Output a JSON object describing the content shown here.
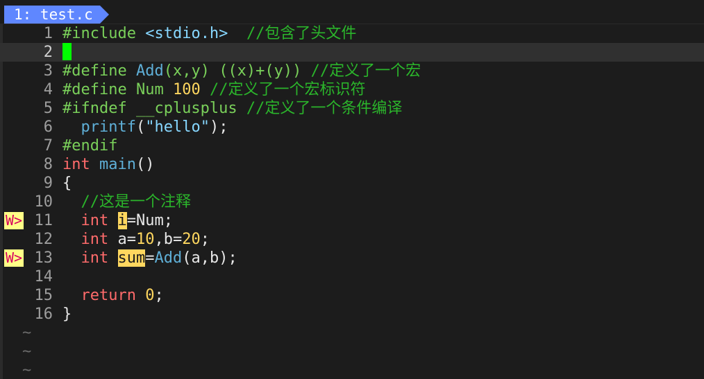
{
  "tabline": {
    "active_tab": "1: test.c"
  },
  "colors": {
    "tab_bg": "#5f87ff",
    "cursor": "#00ff00",
    "warning_sign_bg": "#ffff87",
    "warning_sign_fg": "#d7005f",
    "preprocessor": "#7ad05a",
    "comment": "#2bb52b",
    "function": "#5fafd7",
    "keyword": "#ff6b6b",
    "number": "#ffd75f"
  },
  "editor": {
    "current_line": 2,
    "lines": [
      {
        "num": "1",
        "sign": "",
        "tokens": [
          {
            "t": "#include",
            "c": "pp"
          },
          {
            "t": " ",
            "c": "op"
          },
          {
            "t": "<stdio.h>",
            "c": "str"
          },
          {
            "t": "  ",
            "c": "op"
          },
          {
            "t": "//包含了头文件",
            "c": "cm"
          }
        ]
      },
      {
        "num": "2",
        "sign": "",
        "tokens": [],
        "cursor": true
      },
      {
        "num": "3",
        "sign": "",
        "tokens": [
          {
            "t": "#define",
            "c": "pp"
          },
          {
            "t": " ",
            "c": "op"
          },
          {
            "t": "Add",
            "c": "fn"
          },
          {
            "t": "(x,y) ((x)+(y)) ",
            "c": "pp"
          },
          {
            "t": "//定义了一个宏",
            "c": "cm"
          }
        ]
      },
      {
        "num": "4",
        "sign": "",
        "tokens": [
          {
            "t": "#define Num ",
            "c": "pp"
          },
          {
            "t": "100",
            "c": "nm"
          },
          {
            "t": " ",
            "c": "op"
          },
          {
            "t": "//定义了一个宏标识符",
            "c": "cm"
          }
        ]
      },
      {
        "num": "5",
        "sign": "",
        "tokens": [
          {
            "t": "#ifndef __cplusplus ",
            "c": "pp"
          },
          {
            "t": "//定义了一个条件编译",
            "c": "cm"
          }
        ]
      },
      {
        "num": "6",
        "sign": "",
        "tokens": [
          {
            "t": "  ",
            "c": "op"
          },
          {
            "t": "printf",
            "c": "fn"
          },
          {
            "t": "(",
            "c": "op"
          },
          {
            "t": "\"hello\"",
            "c": "str"
          },
          {
            "t": ");",
            "c": "op"
          }
        ]
      },
      {
        "num": "7",
        "sign": "",
        "tokens": [
          {
            "t": "#endif",
            "c": "pp"
          }
        ]
      },
      {
        "num": "8",
        "sign": "",
        "tokens": [
          {
            "t": "int",
            "c": "kw"
          },
          {
            "t": " ",
            "c": "op"
          },
          {
            "t": "main",
            "c": "fn"
          },
          {
            "t": "()",
            "c": "op"
          }
        ]
      },
      {
        "num": "9",
        "sign": "",
        "tokens": [
          {
            "t": "{",
            "c": "op"
          }
        ]
      },
      {
        "num": "10",
        "sign": "",
        "tokens": [
          {
            "t": "  ",
            "c": "op"
          },
          {
            "t": "//这是一个注释",
            "c": "cm"
          }
        ]
      },
      {
        "num": "11",
        "sign": "W>",
        "tokens": [
          {
            "t": "  ",
            "c": "op"
          },
          {
            "t": "int",
            "c": "kw"
          },
          {
            "t": " ",
            "c": "op"
          },
          {
            "t": "i",
            "c": "hl"
          },
          {
            "t": "=Num;",
            "c": "op"
          }
        ]
      },
      {
        "num": "12",
        "sign": "",
        "tokens": [
          {
            "t": "  ",
            "c": "op"
          },
          {
            "t": "int",
            "c": "kw"
          },
          {
            "t": " a=",
            "c": "op"
          },
          {
            "t": "10",
            "c": "nm"
          },
          {
            "t": ",b=",
            "c": "op"
          },
          {
            "t": "20",
            "c": "nm"
          },
          {
            "t": ";",
            "c": "op"
          }
        ]
      },
      {
        "num": "13",
        "sign": "W>",
        "tokens": [
          {
            "t": "  ",
            "c": "op"
          },
          {
            "t": "int",
            "c": "kw"
          },
          {
            "t": " ",
            "c": "op"
          },
          {
            "t": "sum",
            "c": "hl"
          },
          {
            "t": "=",
            "c": "op"
          },
          {
            "t": "Add",
            "c": "fn"
          },
          {
            "t": "(a,b);",
            "c": "op"
          }
        ]
      },
      {
        "num": "14",
        "sign": "",
        "tokens": []
      },
      {
        "num": "15",
        "sign": "",
        "tokens": [
          {
            "t": "  ",
            "c": "op"
          },
          {
            "t": "return",
            "c": "kw"
          },
          {
            "t": " ",
            "c": "op"
          },
          {
            "t": "0",
            "c": "nm"
          },
          {
            "t": ";",
            "c": "op"
          }
        ]
      },
      {
        "num": "16",
        "sign": "",
        "tokens": [
          {
            "t": "}",
            "c": "op"
          }
        ]
      }
    ],
    "filler_lines": [
      "~",
      "~",
      "~"
    ]
  }
}
